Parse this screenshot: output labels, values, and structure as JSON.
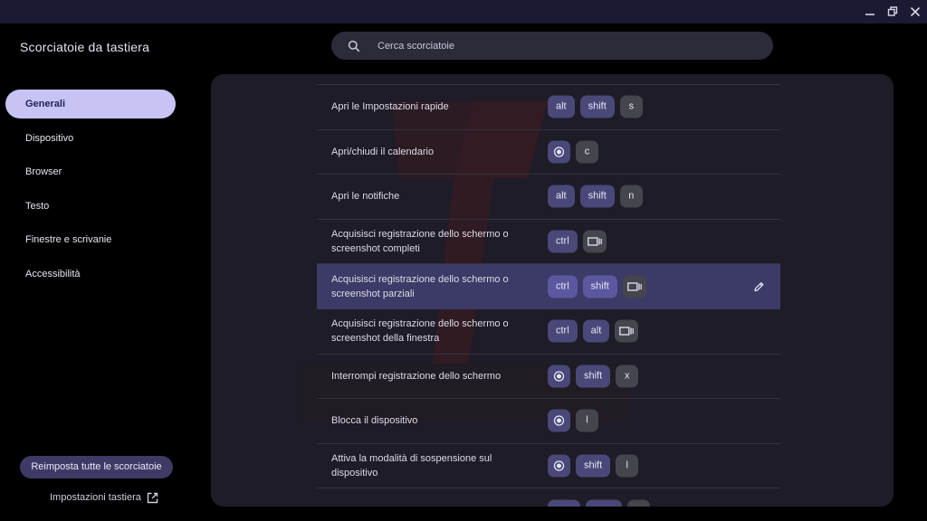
{
  "window": {
    "controls": [
      "minimize-icon",
      "restore-icon",
      "close-icon"
    ]
  },
  "app": {
    "title": "Scorciatoie da tastiera"
  },
  "search": {
    "placeholder": "Cerca scorciatoie"
  },
  "sidebar": {
    "items": [
      {
        "label": "Generali",
        "active": true
      },
      {
        "label": "Dispositivo",
        "active": false
      },
      {
        "label": "Browser",
        "active": false
      },
      {
        "label": "Testo",
        "active": false
      },
      {
        "label": "Finestre e scrivanie",
        "active": false
      },
      {
        "label": "Accessibilità",
        "active": false
      }
    ],
    "reset_label": "Reimposta tutte le scorciatoie",
    "keyboard_settings_label": "Impostazioni tastiera"
  },
  "shortcuts": [
    {
      "label": "Apri le Impostazioni rapide",
      "keys": [
        "alt",
        "shift",
        "s"
      ]
    },
    {
      "label": "Apri/chiudi il calendario",
      "keys": [
        "launcher-icon",
        "c"
      ]
    },
    {
      "label": "Apri le notifiche",
      "keys": [
        "alt",
        "shift",
        "n"
      ]
    },
    {
      "label": "Acquisisci registrazione dello schermo o screenshot completi",
      "keys": [
        "ctrl",
        "show-windows-icon"
      ]
    },
    {
      "label": "Acquisisci registrazione dello schermo o screenshot parziali",
      "keys": [
        "ctrl",
        "shift",
        "show-windows-icon"
      ],
      "selected": true
    },
    {
      "label": "Acquisisci registrazione dello schermo o screenshot della finestra",
      "keys": [
        "ctrl",
        "alt",
        "show-windows-icon"
      ]
    },
    {
      "label": "Interrompi registrazione dello schermo",
      "keys": [
        "launcher-icon",
        "shift",
        "x"
      ]
    },
    {
      "label": "Blocca il dispositivo",
      "keys": [
        "launcher-icon",
        "l"
      ]
    },
    {
      "label": "Attiva la modalità di sospensione sul dispositivo",
      "keys": [
        "launcher-icon",
        "shift",
        "l"
      ]
    }
  ],
  "colors": {
    "accent": "#c7c4f5",
    "selected_row": "#3c3a66",
    "modifier_key": "#4a4878",
    "letter_key": "#45454e",
    "panel": "#1d1c27"
  }
}
